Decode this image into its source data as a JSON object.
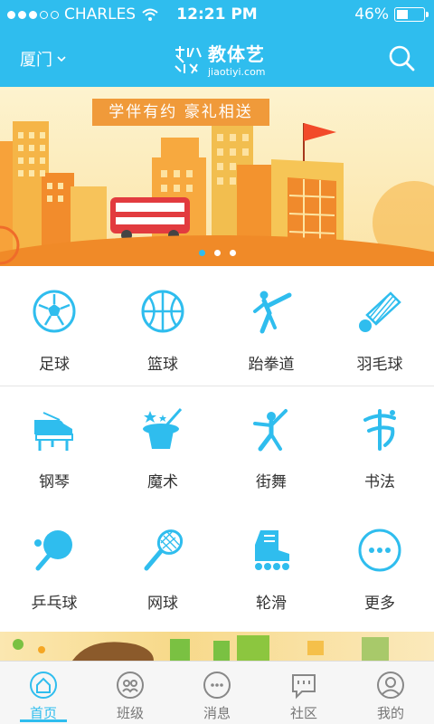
{
  "status_bar": {
    "carrier": "CHARLES",
    "time": "12:21 PM",
    "battery_text": "46%",
    "battery_level": 0.46
  },
  "header": {
    "city": "厦门",
    "logo_text": "教体艺",
    "logo_url": "jiaotiyi.com"
  },
  "banner": {
    "tag": "学伴有约 豪礼相送",
    "page_count": 3,
    "active_page": 0
  },
  "categories": [
    {
      "label": "足球",
      "icon": "soccer-ball-icon"
    },
    {
      "label": "篮球",
      "icon": "basketball-icon"
    },
    {
      "label": "跆拳道",
      "icon": "taekwondo-icon"
    },
    {
      "label": "羽毛球",
      "icon": "shuttlecock-icon"
    },
    {
      "label": "钢琴",
      "icon": "piano-icon"
    },
    {
      "label": "魔术",
      "icon": "magic-hat-icon"
    },
    {
      "label": "街舞",
      "icon": "street-dance-icon"
    },
    {
      "label": "书法",
      "icon": "calligraphy-icon"
    },
    {
      "label": "乒乓球",
      "icon": "ping-pong-icon"
    },
    {
      "label": "网球",
      "icon": "tennis-racket-icon"
    },
    {
      "label": "轮滑",
      "icon": "roller-skate-icon"
    },
    {
      "label": "更多",
      "icon": "more-icon"
    }
  ],
  "tabs": [
    {
      "label": "首页",
      "icon": "home-icon",
      "active": true
    },
    {
      "label": "班级",
      "icon": "class-icon",
      "active": false
    },
    {
      "label": "消息",
      "icon": "message-icon",
      "active": false
    },
    {
      "label": "社区",
      "icon": "community-icon",
      "active": false
    },
    {
      "label": "我的",
      "icon": "profile-icon",
      "active": false
    }
  ],
  "colors": {
    "accent": "#2fbdee",
    "banner_tag": "#f09a3a",
    "text": "#333333"
  }
}
